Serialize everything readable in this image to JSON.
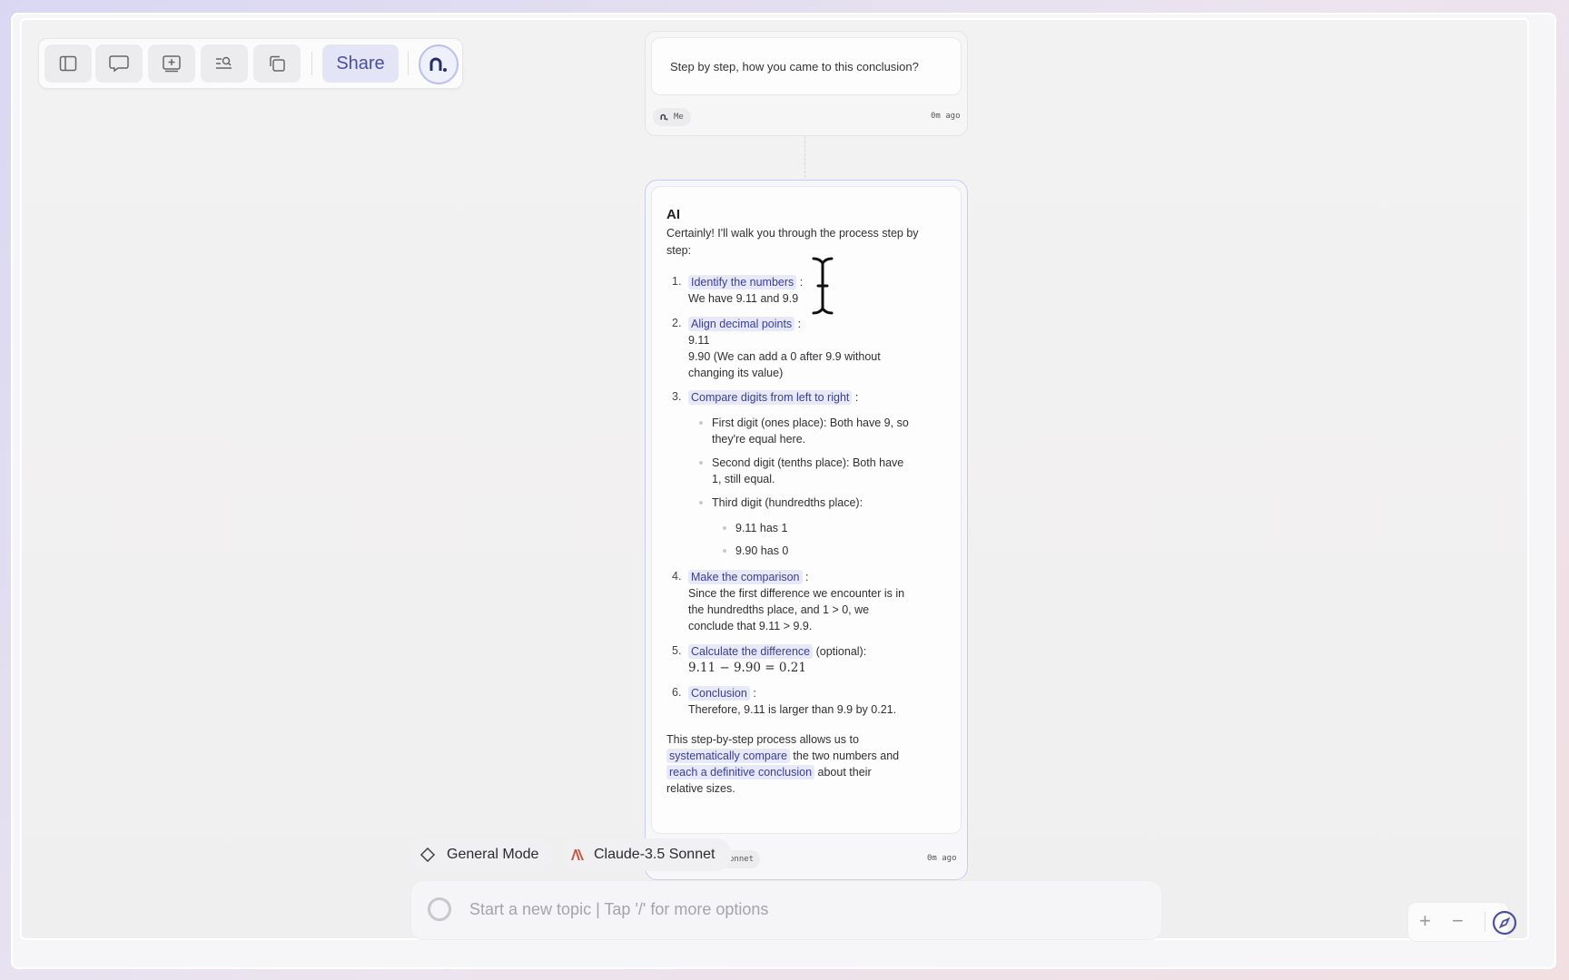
{
  "toolbar": {
    "icons": [
      "sidebar-icon",
      "chat-icon",
      "add-card-icon",
      "search-list-icon",
      "copy-icon"
    ],
    "share_label": "Share",
    "avatar_letter": "n."
  },
  "question_card": {
    "text": "Step by step, how you came to this conclusion?",
    "author": "Me",
    "time": "0m ago"
  },
  "answer_card": {
    "title": "AI",
    "intro": "Certainly! I'll walk you through the process step by step:",
    "steps": [
      {
        "num": "1.",
        "heading": "Identify the numbers",
        "suffix": ":",
        "body": [
          "We have 9.11 and 9.9"
        ]
      },
      {
        "num": "2.",
        "heading": "Align decimal points",
        "suffix": ":",
        "body": [
          "9.11",
          "9.90 (We can add a 0 after 9.9 without",
          "changing its value)"
        ]
      },
      {
        "num": "3.",
        "heading": "Compare digits from left to right",
        "suffix": ":",
        "bullets": [
          [
            "First digit (ones place): Both have 9, so",
            "they're equal here."
          ],
          [
            "Second digit (tenths place): Both have",
            "1, still equal."
          ],
          [
            "Third digit (hundredths place):"
          ]
        ],
        "subbullets": [
          "9.11 has 1",
          "9.90 has 0"
        ]
      },
      {
        "num": "4.",
        "heading": "Make the comparison",
        "suffix": ":",
        "body": [
          "Since the first difference we encounter is in",
          "the hundredths place, and 1 > 0, we",
          "conclude that 9.11 > 9.9."
        ]
      },
      {
        "num": "5.",
        "heading": "Calculate the difference",
        "suffix": "(optional):",
        "math": "9.11 − 9.90 = 0.21"
      },
      {
        "num": "6.",
        "heading": "Conclusion",
        "suffix": ":",
        "body": [
          "Therefore, 9.11 is larger than 9.9 by 0.21."
        ]
      }
    ],
    "outro": {
      "line1": "This step-by-step process allows us to",
      "hl1": "systematically compare",
      "line2": "the two numbers and",
      "hl2": "reach a definitive conclusion",
      "line3": "about their",
      "line4": "relative sizes."
    },
    "model_chip_partial": "onnet",
    "time": "0m ago"
  },
  "mode_bar": {
    "general_mode": "General Mode",
    "model": "Claude-3.5 Sonnet"
  },
  "input": {
    "placeholder": "Start a new topic | Tap '/' for more options"
  },
  "zoom": {
    "plus": "+",
    "minus": "−"
  },
  "colors": {
    "accent": "#4c4fa0",
    "highlight_bg": "#e8e9f8",
    "card_border": "#c9ccef"
  }
}
